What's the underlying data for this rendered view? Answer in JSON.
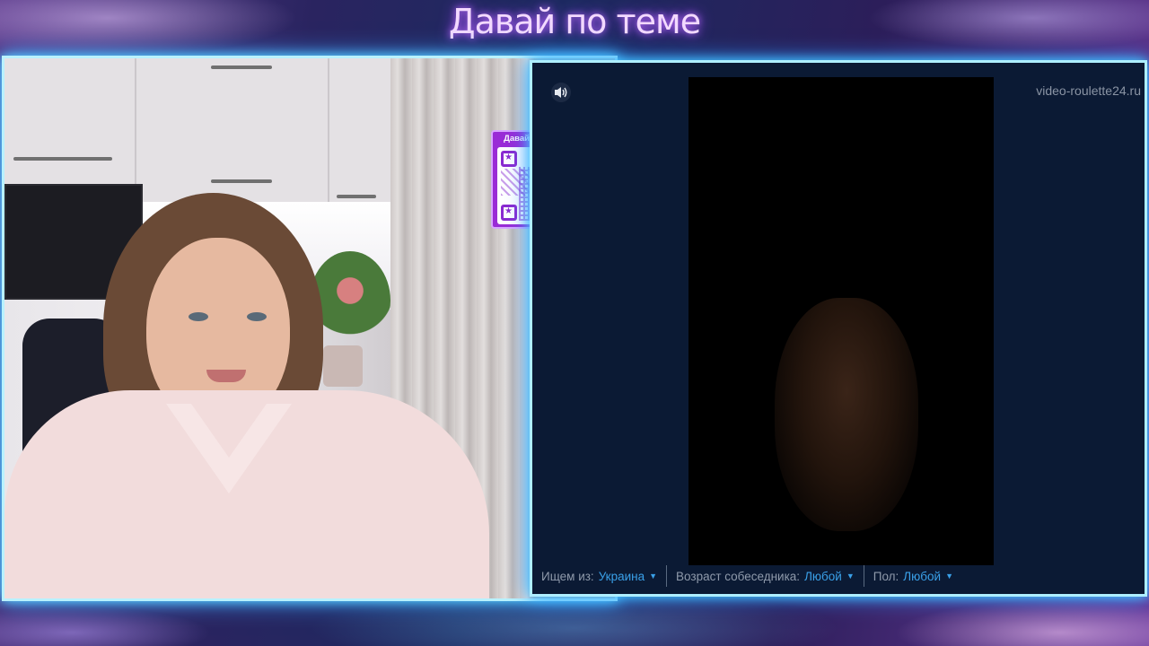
{
  "header": {
    "title": "Давай по теме"
  },
  "qr_card": {
    "label": "Давай по теме"
  },
  "remote_video": {
    "watermark": "video-roulette24.ru",
    "speaker_icon": "speaker-icon"
  },
  "filters": {
    "country_label": "Ищем из:",
    "country_value": "Украина",
    "age_label": "Возраст собеседника:",
    "age_value": "Любой",
    "gender_label": "Пол:",
    "gender_value": "Любой"
  },
  "colors": {
    "accent": "#3aa0e8",
    "border_glow": "#4ad0ff",
    "qr_purple": "#9a2bd6"
  }
}
